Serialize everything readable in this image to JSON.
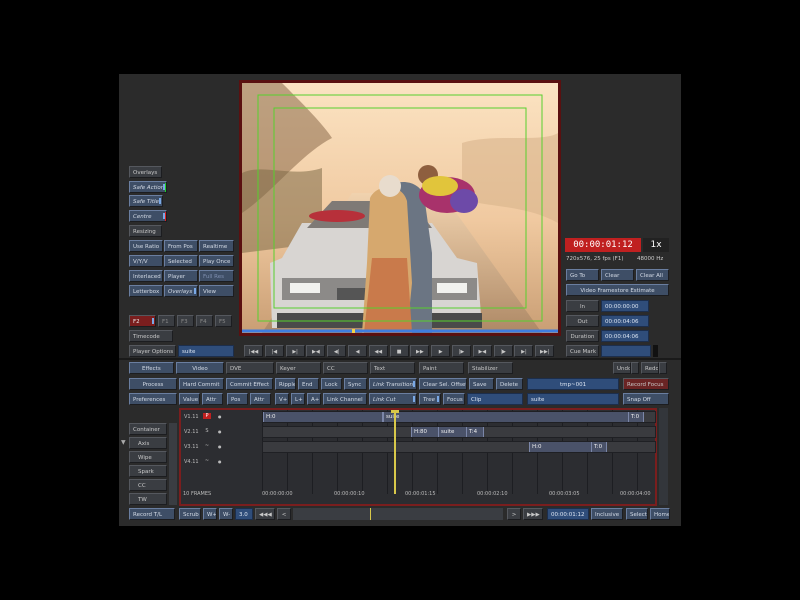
{
  "left_panel": {
    "overlays": "Overlays",
    "safe_action": "Safe Action",
    "safe_title": "Safe Title",
    "centre": "Centre",
    "resizing": "Resizing",
    "use_ratio": "Use Ratio",
    "from_pos": "From Pos",
    "realtime": "Realtime",
    "vyuv": "V/Y/V",
    "selected": "Selected",
    "play_once": "Play Once",
    "interlaced": "Interlaced",
    "player": "Player",
    "full_res": "Full Res",
    "letterbox": "Letterbox",
    "overlays2": "Overlays",
    "view": "View",
    "f2": "F2",
    "f1": "F1",
    "f3": "F3",
    "f4": "F4",
    "f5": "F5",
    "timecode_btn": "Timecode",
    "player_options": "Player Options",
    "player_options_value": "suite"
  },
  "right_panel": {
    "timecode": "00:00:01:12",
    "speed": "1x",
    "format": "720x576, 25 fps (F1)",
    "audio": "48000 Hz",
    "go_to": "Go To",
    "clear": "Clear",
    "clear_all": "Clear All",
    "estimate": "Video Framestore Estimate",
    "in_label": "In",
    "in_value": "00:00:00:00",
    "out_label": "Out",
    "out_value": "00:00:04:06",
    "duration_label": "Duration",
    "duration_value": "00:00:04:06",
    "cue_mark": "Cue Mark"
  },
  "transport": [
    "|◀◀",
    "|◀",
    "▶|",
    "▶◀",
    "◀|",
    "◀",
    "◀◀",
    "■",
    "▶▶",
    "▶",
    "|▶",
    "▶◀",
    "|▶",
    "▶|",
    "▶▶|"
  ],
  "effects_row": {
    "effects": "Effects",
    "video": "Video",
    "dve": "DVE",
    "keyer": "Keyer",
    "cc": "CC",
    "text": "Text",
    "paint": "Paint",
    "stabilizer": "Stabilizer",
    "undo": "Undo",
    "redo": "Redo"
  },
  "process_row": {
    "process": "Process",
    "hard_commit": "Hard Commit",
    "commit_effect": "Commit Effect",
    "ripple": "Ripple",
    "end": "End",
    "lock": "Lock",
    "sync": "Sync",
    "link_transition": "Link Transition",
    "clear_sel_offset": "Clear Sel. Offset",
    "save": "Save",
    "delete": "Delete",
    "clip_name": "tmp~001",
    "record_focus": "Record Focus"
  },
  "prefs_row": {
    "preferences": "Preferences",
    "value": "Value",
    "attr": "Attr",
    "pos": "Pos",
    "attr2": "Attr",
    "vplus": "V+",
    "lplus": "L+",
    "aplus": "A+",
    "link_channel": "Link Channel",
    "link_cut": "Link Cut",
    "tree": "Tree",
    "focus": "Focus",
    "clip": "Clip",
    "focus_value": "suite",
    "snap_off": "Snap Off"
  },
  "side_tools": {
    "container": "Container",
    "axis": "Axis",
    "wipe": "Wipe",
    "spark": "Spark",
    "cc": "CC",
    "tw": "TW"
  },
  "tracks": [
    {
      "name": "V1.11",
      "flag": "P",
      "segment_label": "H:0",
      "segment_label2": "suite",
      "segment_label3": "T:0"
    },
    {
      "name": "V2.11",
      "flag": "S",
      "segment_label": "H:80",
      "segment_label2": "suite",
      "segment_label3": "T:4"
    },
    {
      "name": "V3.11",
      "flag": "~",
      "segment_label": "H:0",
      "segment_label3": "T:0"
    },
    {
      "name": "V4.11",
      "flag": "~"
    }
  ],
  "ruler": {
    "frames": "10 FRAMES",
    "ticks": [
      "00:00:00:00",
      "00:00:00:10",
      "00:00:01:15",
      "00:00:02:10",
      "00:00:03:05",
      "00:00:04:00"
    ]
  },
  "bottom_bar": {
    "record_tl": "Record T/L",
    "scrub": "Scrub",
    "wplus": "W+",
    "wminus": "W-",
    "zoom": "3.0",
    "rewind": "◀◀◀",
    "prev": "<",
    "next": ">",
    "ffwd": "▶▶▶",
    "timecode": "00:00:01:12",
    "inclusive": "Inclusive",
    "select": "Select",
    "home": "Home"
  },
  "colors": {
    "accent_red": "#c02020",
    "safe_green": "#1fd227",
    "field_blue": "#2f4d7a",
    "playhead": "#d8c84a"
  }
}
